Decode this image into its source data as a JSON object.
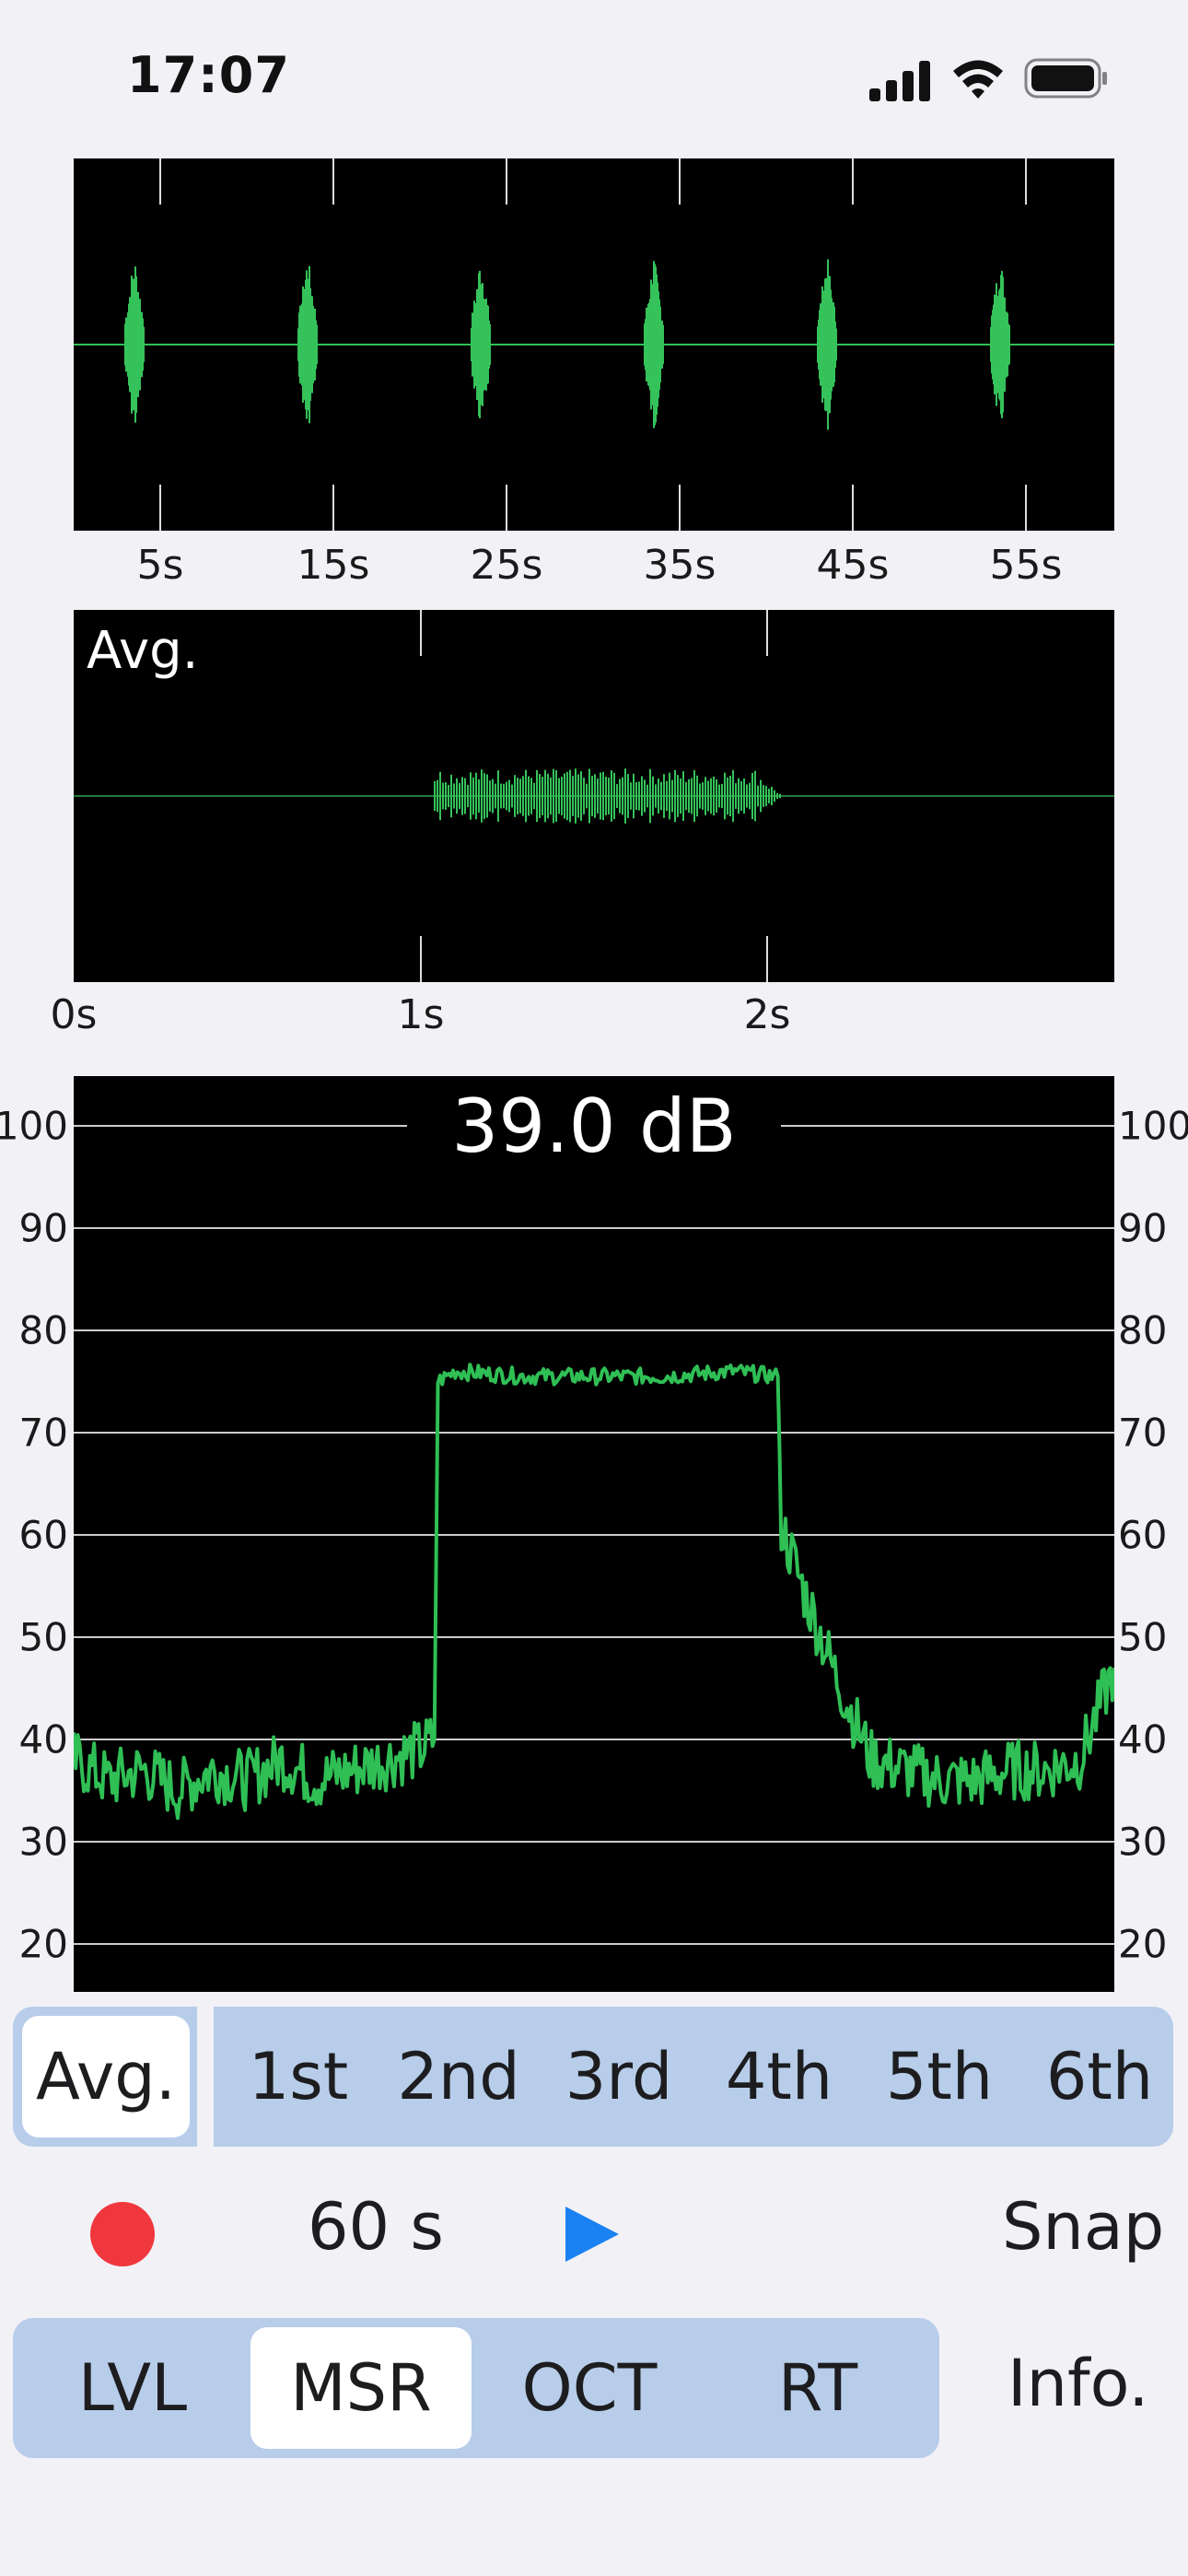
{
  "status_bar": {
    "time": "17:07"
  },
  "overview": {
    "tick_labels": [
      "5s",
      "15s",
      "25s",
      "35s",
      "45s",
      "55s"
    ]
  },
  "average_wave": {
    "label": "Avg.",
    "tick_labels": [
      "0s",
      "1s",
      "2s"
    ]
  },
  "level_chart": {
    "readout": "39.0 dB",
    "y_labels": [
      "100",
      "90",
      "80",
      "70",
      "60",
      "50",
      "40",
      "30",
      "20"
    ]
  },
  "chart_data": {
    "type": "line",
    "title": "39.0 dB",
    "x": [
      0.0,
      0.1,
      0.2,
      0.3,
      0.4,
      0.5,
      0.6,
      0.7,
      0.8,
      0.9,
      1.0,
      1.04,
      1.05,
      1.1,
      1.3,
      1.5,
      1.7,
      1.9,
      2.03,
      2.04,
      2.1,
      2.2,
      2.3,
      2.4,
      2.5,
      2.6,
      2.7,
      2.8,
      2.9,
      3.0
    ],
    "series": [
      {
        "values": [
          38,
          36,
          37,
          35,
          37,
          36,
          38,
          36,
          37,
          38,
          39,
          40,
          75,
          76,
          75.5,
          75.5,
          75.5,
          76,
          75.5,
          61,
          55,
          46,
          38,
          37,
          36,
          36,
          37,
          37,
          38,
          47
        ]
      }
    ],
    "ylim": [
      20,
      100
    ],
    "grid": true,
    "color": "#2fbf55"
  },
  "take_selector": {
    "options": [
      "Avg.",
      "1st",
      "2nd",
      "3rd",
      "4th",
      "5th",
      "6th"
    ],
    "selected": "Avg."
  },
  "controls": {
    "duration": "60 s",
    "snap_label": "Snap",
    "record_color": "#f0373d",
    "play_color": "#1a82f2"
  },
  "mode_tabs": {
    "options": [
      "LVL",
      "MSR",
      "OCT",
      "RT"
    ],
    "selected": "MSR"
  },
  "info_label": "Info."
}
